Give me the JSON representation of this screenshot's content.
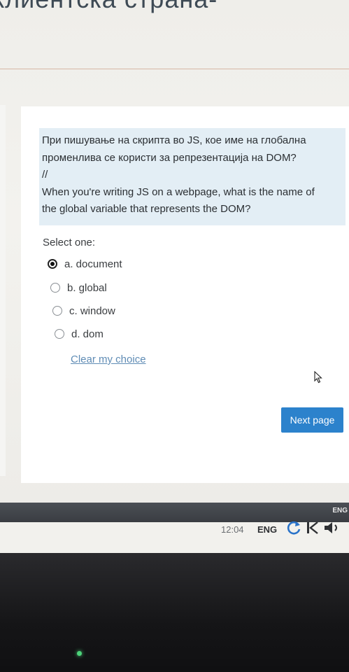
{
  "page": {
    "top_heading": "клиентска страна-"
  },
  "question": {
    "text_mk_line1": "При пишување на скрипта во JS, кое име на глобална",
    "text_mk_line2": "променлива се користи за репрезентација на DOM?",
    "separator": "//",
    "text_en_line1": "When you're writing JS on a webpage, what is the name of",
    "text_en_line2": "the global variable that represents the DOM?"
  },
  "answer": {
    "select_label": "Select one:",
    "options": [
      {
        "label": "a. document",
        "selected": true
      },
      {
        "label": "b. global",
        "selected": false
      },
      {
        "label": "c. window",
        "selected": false
      },
      {
        "label": "d. dom",
        "selected": false
      }
    ],
    "clear_label": "Clear my choice"
  },
  "navigation": {
    "next_label": "Next page"
  },
  "taskbar": {
    "upper_lang": "ENG",
    "clock": "12:04",
    "lang": "ENG"
  },
  "icons": {
    "cursor": "mouse-pointer-icon",
    "refresh": "refresh-icon",
    "media": "skip-back-icon",
    "volume": "speaker-icon"
  },
  "colors": {
    "accent": "#2c82cc",
    "link": "#5f8cb5",
    "question_bg": "#e3eef5"
  }
}
